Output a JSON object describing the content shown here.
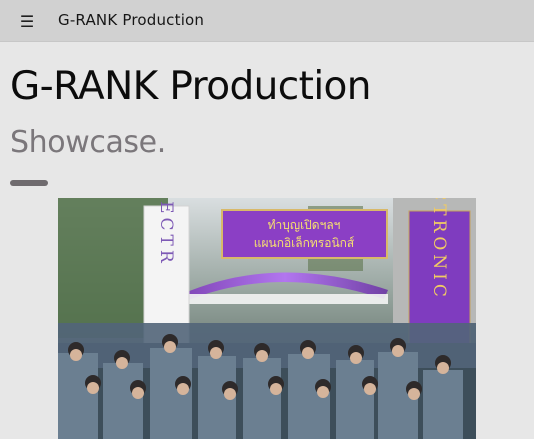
{
  "topbar": {
    "menu_icon": "hamburger-menu-icon",
    "menu_glyph": "☰",
    "brand": "G-RANK Production"
  },
  "main": {
    "title": "G-RANK Production",
    "subtitle": "Showcase.",
    "photo": {
      "banner_white": "ELECTR",
      "banner_purple": "ELECTRONIC",
      "top_sign": "ทำบุญเปิดฯลฯ",
      "top_sign_line2": "แผนกอิเล็กทรอนิกส์"
    }
  },
  "colors": {
    "topbar_bg": "#d1d1d1",
    "page_bg": "#e7e7e7",
    "accent_purple": "#8b3fc5",
    "subtitle": "#7b777b"
  }
}
